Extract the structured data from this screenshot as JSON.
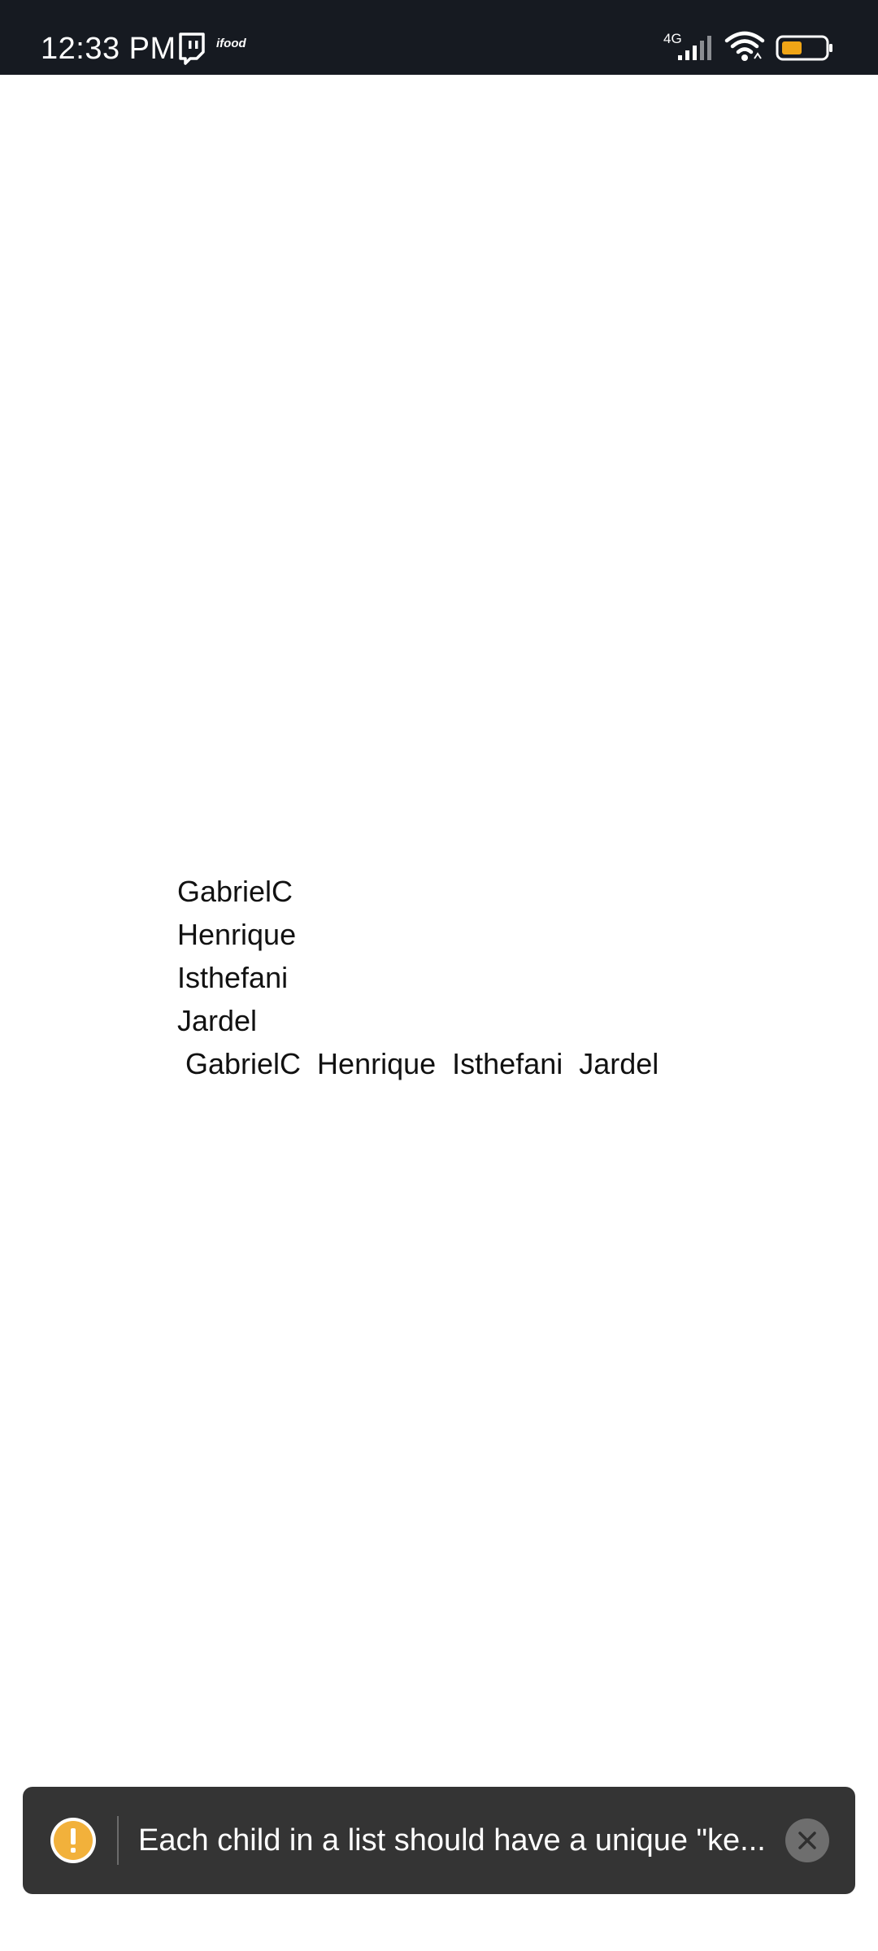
{
  "status_bar": {
    "time": "12:33 PM",
    "network_type": "4G",
    "icons": [
      "twitch-icon",
      "ifood-icon",
      "signal-icon",
      "wifi-icon",
      "battery-icon"
    ],
    "ifood_label": "ifood",
    "battery_color": "#f0a516"
  },
  "list": {
    "items": [
      "GabrielC",
      "Henrique",
      "Isthefani",
      "Jardel"
    ]
  },
  "row": {
    "text": " GabrielC  Henrique  Isthefani  Jardel"
  },
  "toast": {
    "message": "Each child in a list should have a unique \"ke...",
    "icon": "warning-icon",
    "accent_color": "#f2b13b",
    "close_icon": "close-icon"
  }
}
